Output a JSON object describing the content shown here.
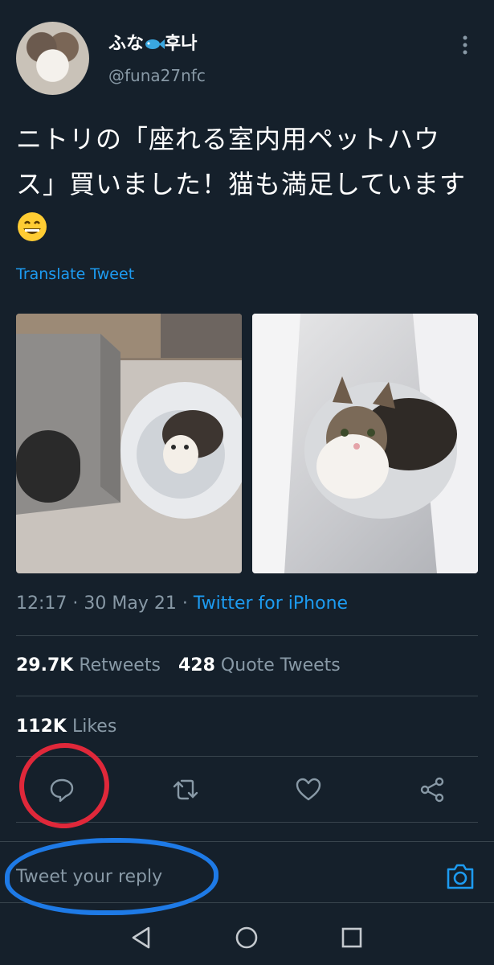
{
  "tweet": {
    "display_name": "ふな",
    "display_name_suffix": "후나",
    "handle": "@funa27nfc",
    "text": "ニトリの「座れる室内用ペットハウス」買いました！猫も満足しています",
    "translate_label": "Translate Tweet",
    "time": "12:17 · 30 May 21 · ",
    "source": "Twitter for iPhone",
    "retweets_count": "29.7K",
    "retweets_label": " Retweets",
    "quotes_count": "428",
    "quotes_label": " Quote Tweets",
    "likes_count": "112K",
    "likes_label": " Likes"
  },
  "reply": {
    "placeholder": "Tweet your reply"
  },
  "icons": {
    "more": "more-vertical-icon",
    "reply": "reply-icon",
    "retweet": "retweet-icon",
    "like": "heart-icon",
    "share": "share-icon",
    "camera": "camera-icon",
    "nav_back": "back-triangle-icon",
    "nav_home": "home-circle-icon",
    "nav_recents": "recents-square-icon"
  },
  "colors": {
    "background": "#15202b",
    "accent": "#1d9bf0",
    "secondary_text": "#8899a6",
    "annotation_red": "#e0283a",
    "annotation_blue": "#1e7ae6"
  }
}
